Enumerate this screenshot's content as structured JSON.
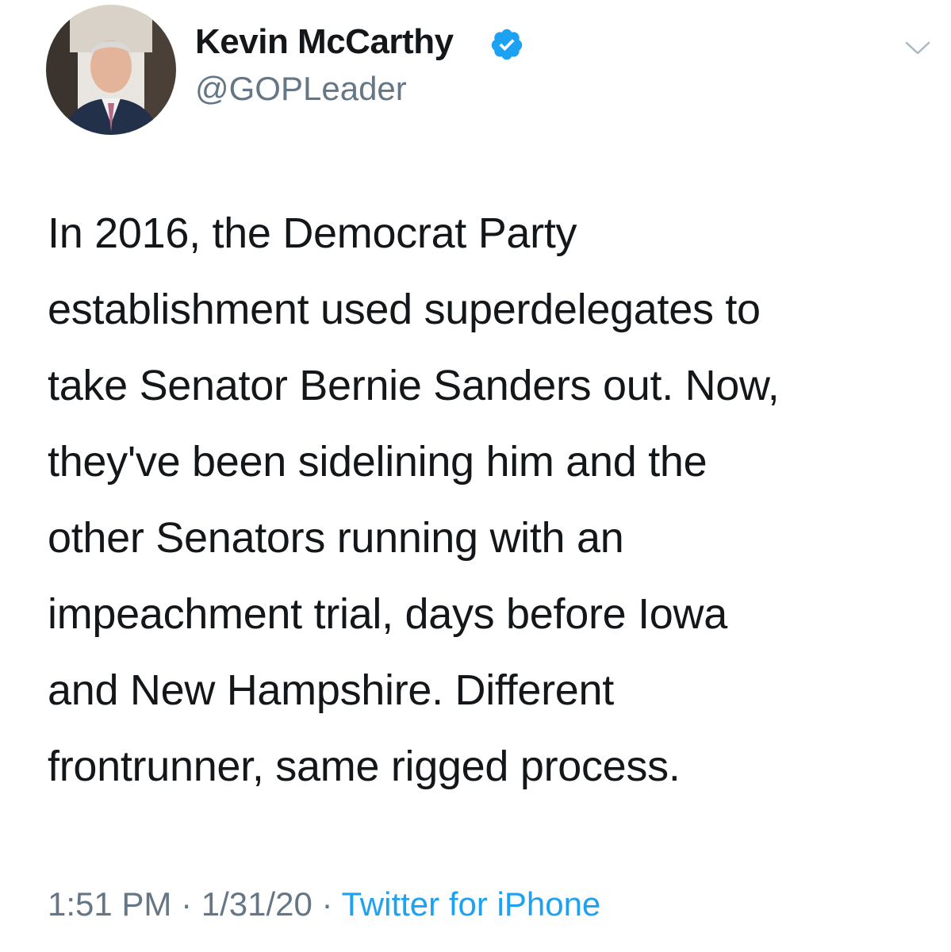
{
  "author": {
    "display_name": "Kevin McCarthy",
    "handle": "@GOPLeader",
    "verified": true
  },
  "tweet": {
    "lines": [
      "In 2016, the Democrat Party",
      "establishment used superdelegates to",
      "take Senator Bernie Sanders out. Now,",
      "they've been sidelining him and the",
      "other Senators running with an",
      "impeachment trial, days before Iowa",
      "and New Hampshire. Different",
      "frontrunner, same rigged process."
    ]
  },
  "meta": {
    "time": "1:51 PM",
    "separator": " · ",
    "date": "1/31/20",
    "source": "Twitter for iPhone"
  },
  "icons": {
    "verified": "verified-badge-icon",
    "menu": "chevron-down-icon"
  },
  "colors": {
    "text": "#14171a",
    "secondary": "#657786",
    "link": "#1da1f2",
    "verified": "#1da1f2"
  }
}
